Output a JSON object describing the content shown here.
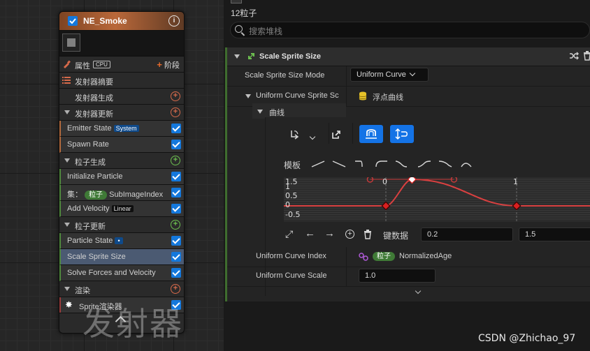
{
  "node": {
    "title": "NE_Smoke",
    "properties_label": "属性",
    "cpu_badge": "CPU",
    "stage_label": "阶段",
    "sections": [
      {
        "label": "发射器摘要"
      },
      {
        "label": "发射器生成"
      },
      {
        "label": "发射器更新"
      },
      {
        "label": "粒子生成"
      },
      {
        "label": "粒子更新"
      },
      {
        "label": "渲染"
      }
    ],
    "items": {
      "emitter_state": "Emitter State",
      "emitter_state_badge": "System",
      "spawn_rate": "Spawn Rate",
      "initialize_particle": "Initialize Particle",
      "sub_prefix": "集：",
      "sub_pill": "粒子",
      "sub_label": "SubImageIndex",
      "add_velocity": "Add Velocity",
      "add_velocity_badge": "Linear",
      "particle_state": "Particle State",
      "scale_sprite_size": "Scale Sprite Size",
      "solve_forces": "Solve Forces and Velocity",
      "sprite_renderer": "Sprite渲染器"
    },
    "watermark": "发射器"
  },
  "panel": {
    "particle_count": "12粒子",
    "search_placeholder": "搜索堆栈",
    "module_title": "Scale Sprite Size",
    "mode_label": "Scale Sprite Size Mode",
    "mode_value": "Uniform Curve",
    "uniform_curve_label": "Uniform Curve Sprite Sc",
    "uniform_curve_value": "浮点曲线",
    "curve_label": "曲线",
    "template_label": "模板",
    "key_data_label": "键数据",
    "key_time": "0.2",
    "key_value": "1.5",
    "curve_index_label": "Uniform Curve Index",
    "curve_index_pill": "粒子",
    "curve_index_value": "NormalizedAge",
    "curve_scale_label": "Uniform Curve Scale",
    "curve_scale_value": "1.0"
  },
  "curve_plot": {
    "y_ticks": [
      "1.5",
      "1",
      "0.5",
      "0",
      "-0.5"
    ],
    "x_ticks": [
      "0",
      "1"
    ],
    "keys": [
      {
        "time": 0,
        "value": 0
      },
      {
        "time": 0.2,
        "value": 1.5
      },
      {
        "time": 1,
        "value": 0
      }
    ],
    "curve_color": "#d94040"
  },
  "watermark_credit": "CSDN @Zhichao_97",
  "colors": {
    "accent": "#1478dc",
    "header_orange": "#b9683a",
    "selected_row": "#4b5a72"
  }
}
